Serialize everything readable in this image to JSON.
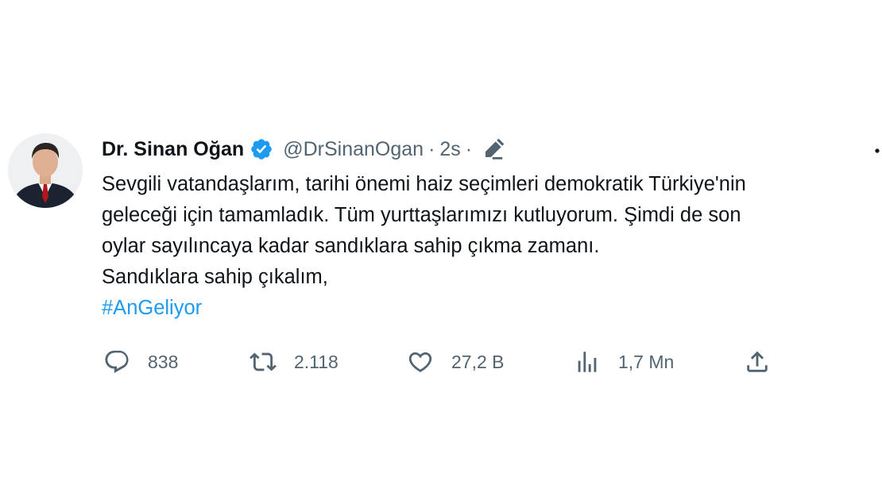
{
  "tweet": {
    "display_name": "Dr. Sinan Oğan",
    "handle": "@DrSinanOgan",
    "separator": "·",
    "time": "2s",
    "lines": [
      "Sevgili vatandaşlarım, tarihi önemi haiz seçimleri demokratik Türkiye'nin",
      "geleceği için tamamladık. Tüm yurttaşlarımızı kutluyorum. Şimdi de son",
      "oylar sayılıncaya kadar sandıklara sahip çıkma zamanı.",
      "Sandıklara sahip çıkalım,"
    ],
    "hashtag": "#AnGeliyor"
  },
  "actions": {
    "replies": "838",
    "retweets": "2.118",
    "likes": "27,2 B",
    "views": "1,7 Mn"
  },
  "icons": {
    "verified": "verified-badge-icon",
    "edit": "edit-pencil-icon",
    "more": "more-dots-icon",
    "reply": "reply-bubble-icon",
    "retweet": "retweet-icon",
    "like": "heart-icon",
    "views": "views-bar-chart-icon",
    "share": "share-upload-icon"
  },
  "colors": {
    "text": "#0f1419",
    "secondary": "#536471",
    "link": "#1d9bf0",
    "verified": "#1d9bf0"
  }
}
